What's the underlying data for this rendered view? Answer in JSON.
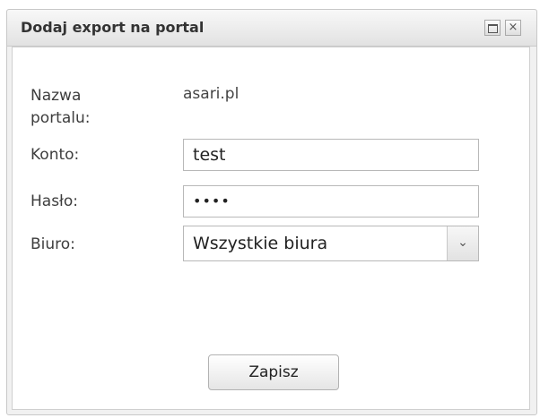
{
  "dialog": {
    "title": "Dodaj export na portal",
    "maximize_icon": "maximize-icon",
    "close_icon": "close-icon",
    "close_glyph": "×"
  },
  "form": {
    "portal_name_label_line1": "Nazwa",
    "portal_name_label_line2": "portalu:",
    "portal_name_value": "asari.pl",
    "account_label": "Konto:",
    "account_value": "test",
    "password_label": "Hasło:",
    "password_value": "••••",
    "office_label": "Biuro:",
    "office_selected": "Wszystkie biura",
    "office_arrow_icon": "chevron-down-icon",
    "office_arrow_glyph": "⌄",
    "save_label": "Zapisz"
  }
}
